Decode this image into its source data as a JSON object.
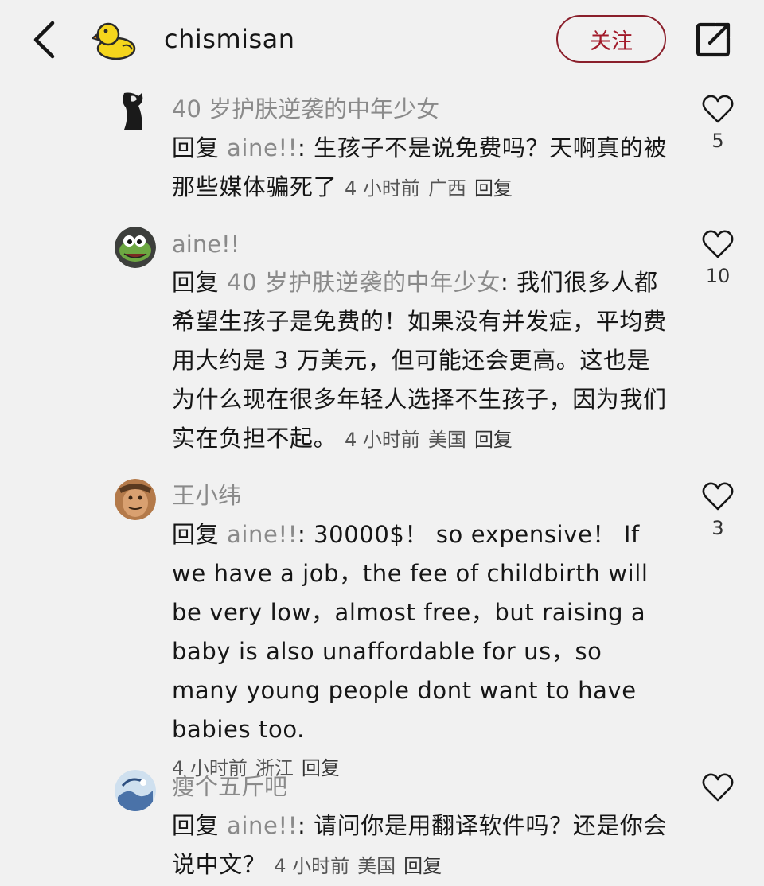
{
  "header": {
    "back_icon": "chevron-left-icon",
    "avatar_icon": "duck-avatar-icon",
    "username": "chismisan",
    "follow_label": "关注",
    "share_icon": "share-external-icon",
    "follow_color": "#a21b2b"
  },
  "comments": [
    {
      "author": "40 岁护肤逆袭的中年少女",
      "reply_word": "回复",
      "reply_target": "aine!!",
      "text": ": 生孩子不是说免费吗？天啊真的被那些媒体骗死了",
      "time": "4 小时前",
      "location": "广西",
      "reply_label": "回复",
      "likes": "5"
    },
    {
      "author": "aine!!",
      "reply_word": "回复",
      "reply_target": "40 岁护肤逆袭的中年少女",
      "text": ": 我们很多人都希望生孩子是免费的！如果没有并发症，平均费用大约是 3 万美元，但可能还会更高。这也是为什么现在很多年轻人选择不生孩子，因为我们实在负担不起。",
      "time": "4 小时前",
      "location": "美国",
      "reply_label": "回复",
      "likes": "10"
    },
    {
      "author": "王小纬",
      "reply_word": "回复",
      "reply_target": "aine!!",
      "text": ": 30000$！ so expensive！ If we have a job，the fee of childbirth will be very low，almost free，but raising a baby is also unaffordable for us，so many young people dont want to have babies too.",
      "time": "4 小时前",
      "location": "浙江",
      "reply_label": "回复",
      "likes": "3"
    },
    {
      "author": "瘦个五斤吧",
      "reply_word": "回复",
      "reply_target": "aine!!",
      "text": ": 请问你是用翻译软件吗？还是你会说中文？",
      "time": "4 小时前",
      "location": "美国",
      "reply_label": "回复",
      "likes": ""
    }
  ],
  "icons": {
    "like": "heart-outline-icon"
  }
}
